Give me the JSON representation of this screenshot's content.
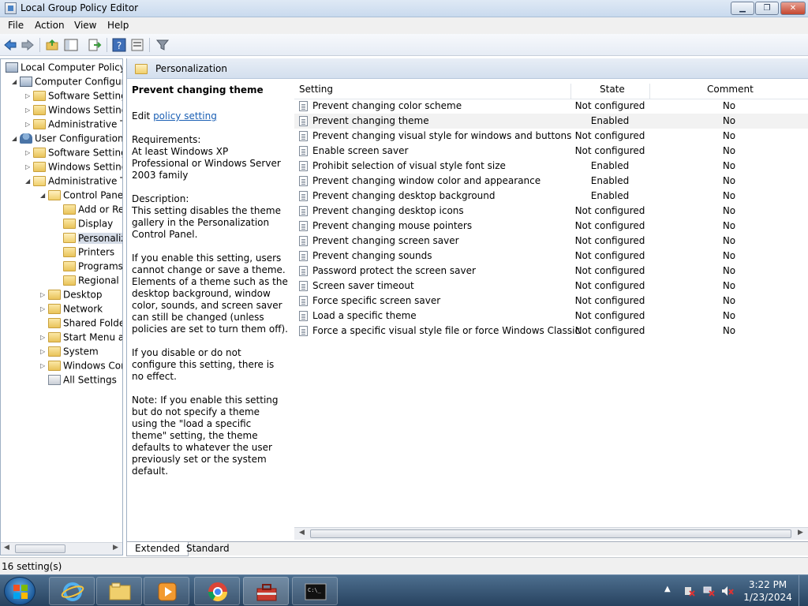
{
  "window": {
    "title": "Local Group Policy Editor"
  },
  "menu": [
    "File",
    "Action",
    "View",
    "Help"
  ],
  "tree": [
    {
      "label": "Local Computer Policy",
      "indent": 0,
      "exp": "",
      "icon": "computer"
    },
    {
      "label": "Computer Configura",
      "indent": 1,
      "exp": "◢",
      "icon": "computer"
    },
    {
      "label": "Software Settings",
      "indent": 2,
      "exp": "▷",
      "icon": "folder"
    },
    {
      "label": "Windows Setting",
      "indent": 2,
      "exp": "▷",
      "icon": "folder"
    },
    {
      "label": "Administrative Te",
      "indent": 2,
      "exp": "▷",
      "icon": "folder"
    },
    {
      "label": "User Configuration",
      "indent": 1,
      "exp": "◢",
      "icon": "user"
    },
    {
      "label": "Software Settings",
      "indent": 2,
      "exp": "▷",
      "icon": "folder"
    },
    {
      "label": "Windows Setting",
      "indent": 2,
      "exp": "▷",
      "icon": "folder"
    },
    {
      "label": "Administrative Te",
      "indent": 2,
      "exp": "◢",
      "icon": "folder-open"
    },
    {
      "label": "Control Panel",
      "indent": 3,
      "exp": "◢",
      "icon": "folder-open"
    },
    {
      "label": "Add or Re",
      "indent": 4,
      "exp": "",
      "icon": "folder"
    },
    {
      "label": "Display",
      "indent": 4,
      "exp": "",
      "icon": "folder"
    },
    {
      "label": "Personaliz",
      "indent": 4,
      "exp": "",
      "icon": "folder-open",
      "selected": true
    },
    {
      "label": "Printers",
      "indent": 4,
      "exp": "",
      "icon": "folder"
    },
    {
      "label": "Programs",
      "indent": 4,
      "exp": "",
      "icon": "folder"
    },
    {
      "label": "Regional a",
      "indent": 4,
      "exp": "",
      "icon": "folder"
    },
    {
      "label": "Desktop",
      "indent": 3,
      "exp": "▷",
      "icon": "folder"
    },
    {
      "label": "Network",
      "indent": 3,
      "exp": "▷",
      "icon": "folder"
    },
    {
      "label": "Shared Folder",
      "indent": 3,
      "exp": "",
      "icon": "folder"
    },
    {
      "label": "Start Menu ar",
      "indent": 3,
      "exp": "▷",
      "icon": "folder"
    },
    {
      "label": "System",
      "indent": 3,
      "exp": "▷",
      "icon": "folder"
    },
    {
      "label": "Windows Cor",
      "indent": 3,
      "exp": "▷",
      "icon": "folder"
    },
    {
      "label": "All Settings",
      "indent": 3,
      "exp": "",
      "icon": "settings"
    }
  ],
  "header": {
    "title": "Personalization"
  },
  "description": {
    "title": "Prevent changing theme",
    "edit_prefix": "Edit ",
    "edit_link": "policy setting",
    "requirements_label": "Requirements:",
    "requirements": "At least Windows XP Professional or Windows Server 2003 family",
    "description_label": "Description:",
    "p1": "This setting disables the theme gallery in the Personalization Control Panel.",
    "p2": "If you enable this setting, users cannot change or save a theme. Elements of a theme such as the desktop background, window color, sounds, and screen saver can still be changed (unless policies are set to turn them off).",
    "p3": "If you disable or do not configure this setting, there is no effect.",
    "p4": "Note: If you enable this setting but do not specify a theme using the \"load a specific theme\" setting, the theme defaults to whatever the user previously set or the system default."
  },
  "columns": {
    "setting": "Setting",
    "state": "State",
    "comment": "Comment"
  },
  "settings": [
    {
      "name": "Prevent changing color scheme",
      "state": "Not configured",
      "comment": "No"
    },
    {
      "name": "Prevent changing theme",
      "state": "Enabled",
      "comment": "No",
      "highlight": true
    },
    {
      "name": "Prevent changing visual style for windows and buttons",
      "state": "Not configured",
      "comment": "No"
    },
    {
      "name": "Enable screen saver",
      "state": "Not configured",
      "comment": "No"
    },
    {
      "name": "Prohibit selection of visual style font size",
      "state": "Enabled",
      "comment": "No"
    },
    {
      "name": "Prevent changing window color and appearance",
      "state": "Enabled",
      "comment": "No"
    },
    {
      "name": "Prevent changing desktop background",
      "state": "Enabled",
      "comment": "No"
    },
    {
      "name": "Prevent changing desktop icons",
      "state": "Not configured",
      "comment": "No"
    },
    {
      "name": "Prevent changing mouse pointers",
      "state": "Not configured",
      "comment": "No"
    },
    {
      "name": "Prevent changing screen saver",
      "state": "Not configured",
      "comment": "No"
    },
    {
      "name": "Prevent changing sounds",
      "state": "Not configured",
      "comment": "No"
    },
    {
      "name": "Password protect the screen saver",
      "state": "Not configured",
      "comment": "No"
    },
    {
      "name": "Screen saver timeout",
      "state": "Not configured",
      "comment": "No"
    },
    {
      "name": "Force specific screen saver",
      "state": "Not configured",
      "comment": "No"
    },
    {
      "name": "Load a specific theme",
      "state": "Not configured",
      "comment": "No"
    },
    {
      "name": "Force a specific visual style file or force Windows Classic",
      "state": "Not configured",
      "comment": "No"
    }
  ],
  "tabs": {
    "extended": "Extended",
    "standard": "Standard"
  },
  "status": {
    "count": "16 setting(s)"
  },
  "taskbar": {
    "time": "3:22 PM",
    "date": "1/23/2024"
  },
  "colors": {
    "accent": "#1a5fb4",
    "taskbar": "#27425f",
    "selected": "#d4dbe6"
  }
}
